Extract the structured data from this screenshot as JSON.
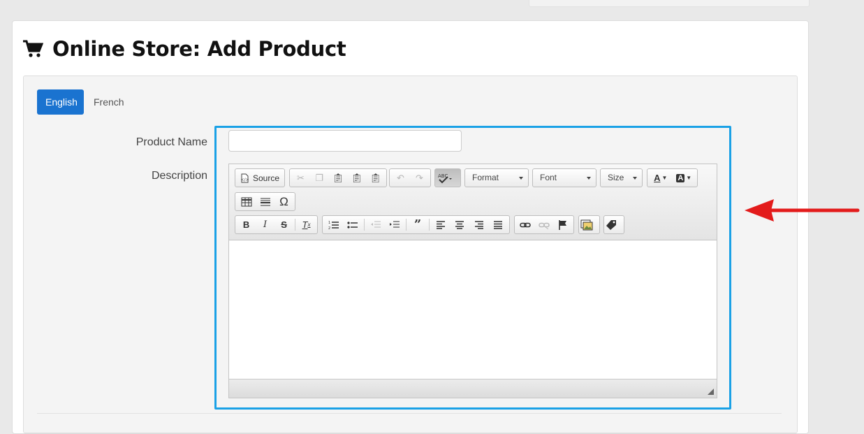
{
  "page": {
    "title": "Online Store: Add Product"
  },
  "tabs": [
    {
      "label": "English",
      "active": true
    },
    {
      "label": "French",
      "active": false
    }
  ],
  "form": {
    "product_name_label": "Product Name",
    "product_name_value": "",
    "description_label": "Description"
  },
  "editor": {
    "source_label": "Source",
    "format_label": "Format",
    "font_label": "Font",
    "size_label": "Size"
  },
  "colors": {
    "primary_tab": "#1a73d0",
    "highlight_border": "#1aa1e6",
    "annotation_arrow": "#e31b1b"
  }
}
